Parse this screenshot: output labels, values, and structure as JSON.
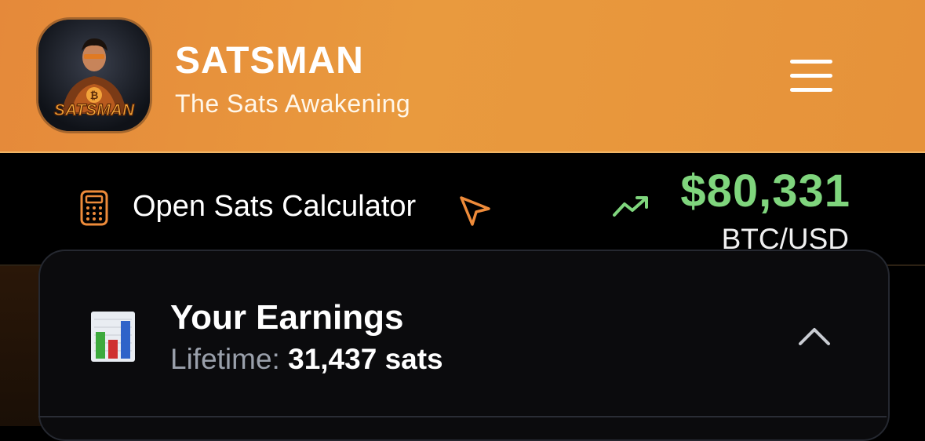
{
  "header": {
    "title": "SATSMAN",
    "subtitle": "The Sats Awakening",
    "avatar_text": "SATSMAN",
    "avatar_icon": "superhero-avatar",
    "menu_icon": "hamburger-menu-icon"
  },
  "ticker": {
    "calculator_label": "Open Sats Calculator",
    "calculator_icon": "calculator-icon",
    "cursor_icon": "pointer-arrow-icon",
    "trend_icon": "trending-up-icon",
    "price": "$80,331",
    "pair": "BTC/USD"
  },
  "earnings": {
    "icon": "bar-chart-icon",
    "title": "Your Earnings",
    "lifetime_label": "Lifetime:",
    "lifetime_value": "31,437 sats",
    "toggle_icon": "chevron-up-icon"
  },
  "colors": {
    "header_orange": "#e99a3e",
    "price_green": "#7fd57d",
    "accent_orange": "#e5893a",
    "card_bg": "#0b0b0d"
  }
}
